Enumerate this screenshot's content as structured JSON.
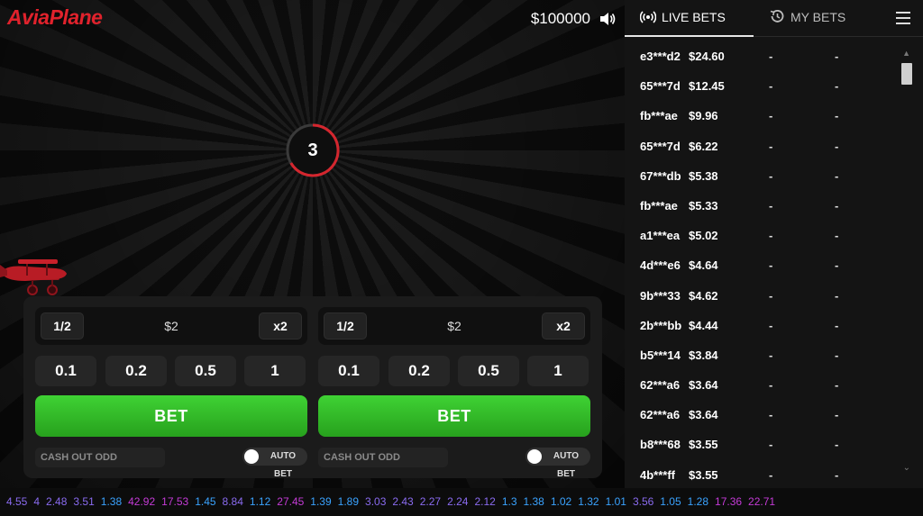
{
  "header": {
    "logo": "AviaPlane",
    "balance": "$100000"
  },
  "game": {
    "countdown": "3"
  },
  "bet_panels": [
    {
      "half_label": "1/2",
      "amount": "$2",
      "double_label": "x2",
      "chips": [
        "0.1",
        "0.2",
        "0.5",
        "1"
      ],
      "bet_label": "BET",
      "cashout_placeholder": "CASH OUT ODD",
      "auto_bet_label": "AUTO BET"
    },
    {
      "half_label": "1/2",
      "amount": "$2",
      "double_label": "x2",
      "chips": [
        "0.1",
        "0.2",
        "0.5",
        "1"
      ],
      "bet_label": "BET",
      "cashout_placeholder": "CASH OUT ODD",
      "auto_bet_label": "AUTO BET"
    }
  ],
  "sidebar": {
    "tabs": [
      {
        "label": "LIVE BETS",
        "active": true
      },
      {
        "label": "MY BETS",
        "active": false
      }
    ],
    "bets": [
      {
        "user": "e3***d2",
        "amount": "$24.60",
        "odd": "-",
        "win": "-"
      },
      {
        "user": "65***7d",
        "amount": "$12.45",
        "odd": "-",
        "win": "-"
      },
      {
        "user": "fb***ae",
        "amount": "$9.96",
        "odd": "-",
        "win": "-"
      },
      {
        "user": "65***7d",
        "amount": "$6.22",
        "odd": "-",
        "win": "-"
      },
      {
        "user": "67***db",
        "amount": "$5.38",
        "odd": "-",
        "win": "-"
      },
      {
        "user": "fb***ae",
        "amount": "$5.33",
        "odd": "-",
        "win": "-"
      },
      {
        "user": "a1***ea",
        "amount": "$5.02",
        "odd": "-",
        "win": "-"
      },
      {
        "user": "4d***e6",
        "amount": "$4.64",
        "odd": "-",
        "win": "-"
      },
      {
        "user": "9b***33",
        "amount": "$4.62",
        "odd": "-",
        "win": "-"
      },
      {
        "user": "2b***bb",
        "amount": "$4.44",
        "odd": "-",
        "win": "-"
      },
      {
        "user": "b5***14",
        "amount": "$3.84",
        "odd": "-",
        "win": "-"
      },
      {
        "user": "62***a6",
        "amount": "$3.64",
        "odd": "-",
        "win": "-"
      },
      {
        "user": "62***a6",
        "amount": "$3.64",
        "odd": "-",
        "win": "-"
      },
      {
        "user": "b8***68",
        "amount": "$3.55",
        "odd": "-",
        "win": "-"
      },
      {
        "user": "4b***ff",
        "amount": "$3.55",
        "odd": "-",
        "win": "-"
      }
    ]
  },
  "history": [
    {
      "value": "4.55",
      "color": "#8a6bf0"
    },
    {
      "value": "4",
      "color": "#8a6bf0"
    },
    {
      "value": "2.48",
      "color": "#8a6bf0"
    },
    {
      "value": "3.51",
      "color": "#8a6bf0"
    },
    {
      "value": "1.38",
      "color": "#3aa3ff"
    },
    {
      "value": "42.92",
      "color": "#c43bd6"
    },
    {
      "value": "17.53",
      "color": "#c43bd6"
    },
    {
      "value": "1.45",
      "color": "#3aa3ff"
    },
    {
      "value": "8.84",
      "color": "#8a6bf0"
    },
    {
      "value": "1.12",
      "color": "#3aa3ff"
    },
    {
      "value": "27.45",
      "color": "#c43bd6"
    },
    {
      "value": "1.39",
      "color": "#3aa3ff"
    },
    {
      "value": "1.89",
      "color": "#3aa3ff"
    },
    {
      "value": "3.03",
      "color": "#8a6bf0"
    },
    {
      "value": "2.43",
      "color": "#8a6bf0"
    },
    {
      "value": "2.27",
      "color": "#8a6bf0"
    },
    {
      "value": "2.24",
      "color": "#8a6bf0"
    },
    {
      "value": "2.12",
      "color": "#8a6bf0"
    },
    {
      "value": "1.3",
      "color": "#3aa3ff"
    },
    {
      "value": "1.38",
      "color": "#3aa3ff"
    },
    {
      "value": "1.02",
      "color": "#3aa3ff"
    },
    {
      "value": "1.32",
      "color": "#3aa3ff"
    },
    {
      "value": "1.01",
      "color": "#3aa3ff"
    },
    {
      "value": "3.56",
      "color": "#8a6bf0"
    },
    {
      "value": "1.05",
      "color": "#3aa3ff"
    },
    {
      "value": "1.28",
      "color": "#3aa3ff"
    },
    {
      "value": "17.36",
      "color": "#c43bd6"
    },
    {
      "value": "22.71",
      "color": "#c43bd6"
    }
  ],
  "colors": {
    "brand": "#e0222c",
    "bet_green": "#32b928",
    "countdown_ring": "#d4262e"
  },
  "icons": {
    "sound": "speaker-icon",
    "live_bets": "broadcast-icon",
    "my_bets": "history-icon",
    "menu": "hamburger-icon",
    "plane": "biplane-icon"
  }
}
